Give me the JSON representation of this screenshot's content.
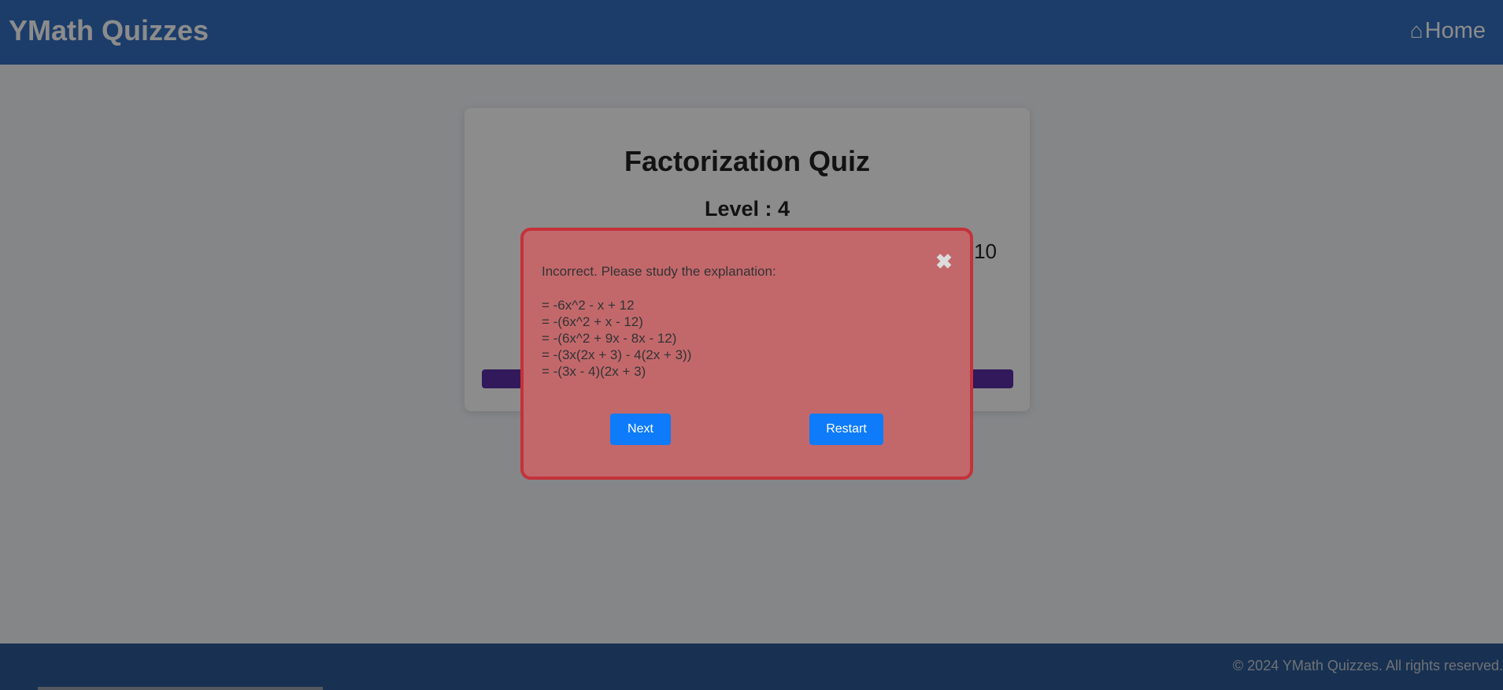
{
  "header": {
    "brand": "YMath Quizzes",
    "home_label": "Home",
    "home_icon": "⌂"
  },
  "quiz": {
    "title": "Factorization Quiz",
    "level": "Level : 4",
    "progress_visible": "10"
  },
  "modal": {
    "message": "Incorrect. Please study the explanation:",
    "explanation": [
      "= -6x^2 - x + 12",
      "= -(6x^2 + x - 12)",
      "= -(6x^2 + 9x - 8x - 12)",
      "= -(3x(2x + 3) - 4(2x + 3))",
      "= -(3x - 4)(2x + 3)"
    ],
    "close_icon": "✖",
    "next_label": "Next",
    "restart_label": "Restart"
  },
  "footer": {
    "copyright": "© 2024 YMath Quizzes. All rights reserved."
  },
  "colors": {
    "header_bg": "#3470c2",
    "footer_bg": "#2c5a95",
    "modal_bg": "#c2686b",
    "modal_border": "#c4323a",
    "button_bg": "#0d7bfa",
    "progress_bar": "#5a2ea6"
  }
}
